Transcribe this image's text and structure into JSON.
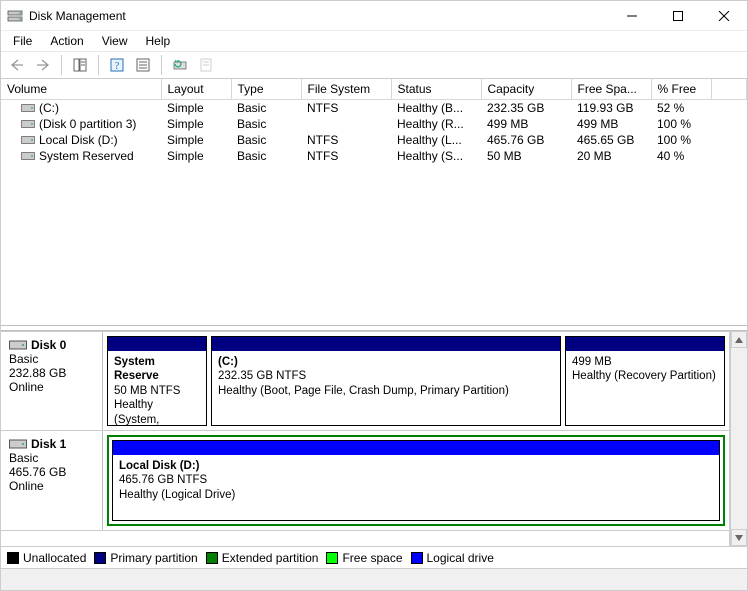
{
  "window": {
    "title": "Disk Management"
  },
  "menubar": {
    "file": "File",
    "action": "Action",
    "view": "View",
    "help": "Help"
  },
  "columns": {
    "volume": "Volume",
    "layout": "Layout",
    "type": "Type",
    "filesystem": "File System",
    "status": "Status",
    "capacity": "Capacity",
    "freespace": "Free Spa...",
    "pctfree": "% Free"
  },
  "volumes": [
    {
      "name": "(C:)",
      "layout": "Simple",
      "type": "Basic",
      "fs": "NTFS",
      "status": "Healthy (B...",
      "capacity": "232.35 GB",
      "free": "119.93 GB",
      "pct": "52 %"
    },
    {
      "name": "(Disk 0 partition 3)",
      "layout": "Simple",
      "type": "Basic",
      "fs": "",
      "status": "Healthy (R...",
      "capacity": "499 MB",
      "free": "499 MB",
      "pct": "100 %"
    },
    {
      "name": "Local Disk (D:)",
      "layout": "Simple",
      "type": "Basic",
      "fs": "NTFS",
      "status": "Healthy (L...",
      "capacity": "465.76 GB",
      "free": "465.65 GB",
      "pct": "100 %"
    },
    {
      "name": "System Reserved",
      "layout": "Simple",
      "type": "Basic",
      "fs": "NTFS",
      "status": "Healthy (S...",
      "capacity": "50 MB",
      "free": "20 MB",
      "pct": "40 %"
    }
  ],
  "disks": {
    "d0": {
      "name": "Disk 0",
      "type": "Basic",
      "size": "232.88 GB",
      "status": "Online",
      "parts": {
        "p0": {
          "label": "System Reserve",
          "line2": "50 MB NTFS",
          "line3": "Healthy (System,"
        },
        "p1": {
          "label": "(C:)",
          "line2": "232.35 GB NTFS",
          "line3": "Healthy (Boot, Page File, Crash Dump, Primary Partition)"
        },
        "p2": {
          "label": "",
          "line2": "499 MB",
          "line3": "Healthy (Recovery Partition)"
        }
      }
    },
    "d1": {
      "name": "Disk 1",
      "type": "Basic",
      "size": "465.76 GB",
      "status": "Online",
      "parts": {
        "p0": {
          "label": "Local Disk  (D:)",
          "line2": "465.76 GB NTFS",
          "line3": "Healthy (Logical Drive)"
        }
      }
    }
  },
  "legend": {
    "unallocated": "Unallocated",
    "primary": "Primary partition",
    "extended": "Extended partition",
    "free": "Free space",
    "logical": "Logical drive"
  },
  "colors": {
    "primary": "#000080",
    "extended": "#008000",
    "free": "#00FF00",
    "logical": "#0000FF",
    "unallocated": "#000000"
  }
}
